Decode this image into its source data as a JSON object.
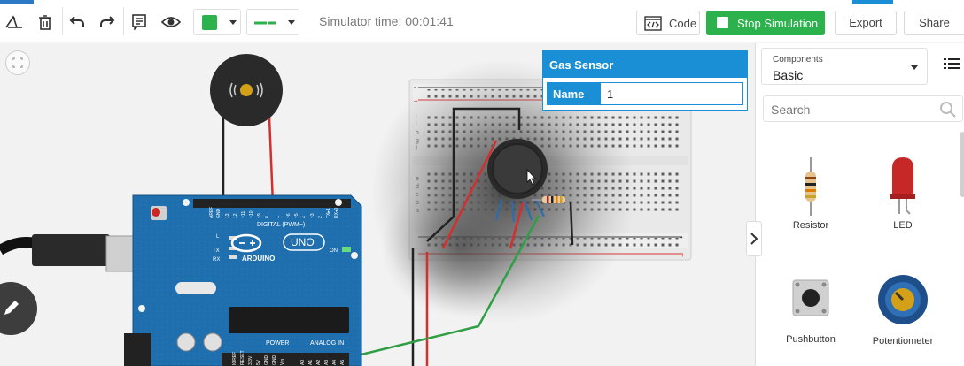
{
  "toolbar": {
    "sim_time_label": "Simulator time: 00:01:41",
    "code_label": "Code",
    "stop_label": "Stop Simulation",
    "export_label": "Export",
    "share_label": "Share",
    "selected_color": "#2bb24c",
    "icons": [
      "rotate-icon",
      "trash-icon",
      "undo-icon",
      "redo-icon",
      "notes-icon",
      "eye-icon",
      "code-icon"
    ]
  },
  "canvas": {
    "board": {
      "brand": "ARDUINO",
      "model": "UNO",
      "digital_label": "DIGITAL (PWM~)",
      "power_label": "POWER",
      "analog_label": "ANALOG IN",
      "led_labels": [
        "L",
        "TX",
        "RX"
      ],
      "on_label": "ON",
      "aref_label": "AREF",
      "gnd_label": "GND",
      "digital_pins": [
        "13",
        "12",
        "~11",
        "~10",
        "~9",
        "8",
        "7",
        "~6",
        "~5",
        "4",
        "~3",
        "2",
        "TX▸1",
        "RX◂0"
      ],
      "power_pins": [
        "IOREF",
        "RESET",
        "3.3V",
        "5V",
        "GND",
        "GND",
        "Vin"
      ],
      "analog_pins": [
        "A0",
        "A1",
        "A2",
        "A3",
        "A4",
        "A5"
      ]
    },
    "breadboard": {
      "row_letters_top": [
        "j",
        "i",
        "h",
        "g",
        "f"
      ],
      "row_letters_bottom": [
        "e",
        "d",
        "c",
        "b",
        "a"
      ],
      "rail_plus": "+",
      "rail_minus": "-"
    }
  },
  "properties": {
    "title": "Gas Sensor",
    "name_label": "Name",
    "name_value": "1"
  },
  "sidebar": {
    "components_small": "Components",
    "components_value": "Basic",
    "search_placeholder": "Search",
    "items": [
      {
        "label": "Resistor",
        "icon": "resistor-icon"
      },
      {
        "label": "LED",
        "icon": "led-icon"
      },
      {
        "label": "Pushbutton",
        "icon": "pushbutton-icon"
      },
      {
        "label": "Potentiometer",
        "icon": "potentiometer-icon"
      }
    ]
  },
  "colors": {
    "accent_blue": "#1a8fd6",
    "start_green": "#2bb24c",
    "arduino_blue": "#1e6aa8"
  }
}
